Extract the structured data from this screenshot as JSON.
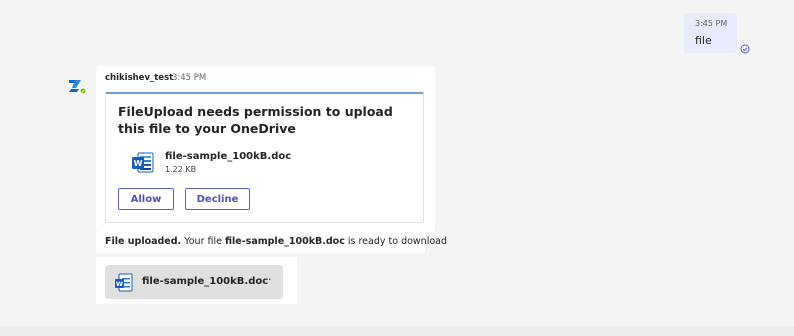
{
  "outgoing": {
    "time": "3:45 PM",
    "text": "file"
  },
  "message": {
    "sender": "chikishev_test",
    "time": "3:45 PM",
    "card": {
      "title": "FileUpload needs permission to upload this file to your OneDrive",
      "file_name": "file-sample_100kB.doc",
      "file_size": "1.22 KB",
      "allow_label": "Allow",
      "decline_label": "Decline"
    }
  },
  "notice": {
    "prefix": "File uploaded.",
    "text1": " Your file ",
    "file": "file-sample_100kB.doc",
    "text2": " is ready to download"
  },
  "attachment": {
    "name": "file-sample_100kB.doc",
    "more": "···"
  },
  "icons": {
    "avatar": "bot-avatar-icon",
    "read": "read-receipt-icon",
    "file": "word-doc-icon"
  },
  "colors": {
    "accent": "#5b5fc7",
    "bubble_out": "#e8ebfa",
    "word_blue": "#185abd",
    "online": "#6bb700"
  }
}
